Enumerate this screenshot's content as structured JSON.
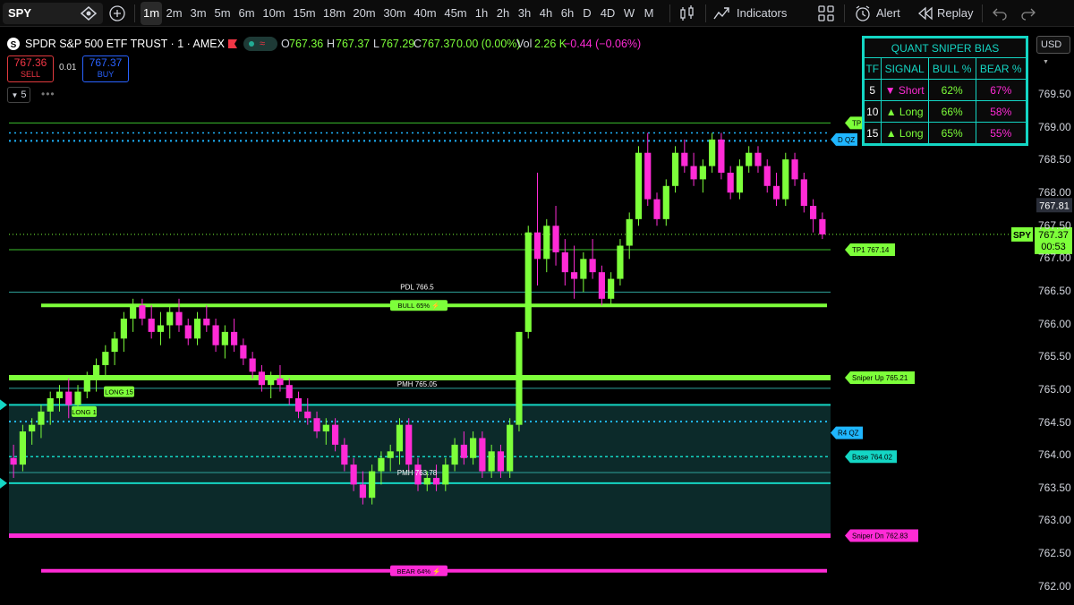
{
  "toolbar": {
    "symbol": "SPY",
    "intervals": [
      "1m",
      "2m",
      "3m",
      "5m",
      "6m",
      "10m",
      "15m",
      "18m",
      "20m",
      "30m",
      "40m",
      "45m",
      "1h",
      "2h",
      "3h",
      "4h",
      "6h",
      "D",
      "4D",
      "W",
      "M"
    ],
    "active_interval": "1m",
    "indicators_label": "Indicators",
    "alert_label": "Alert",
    "replay_label": "Replay"
  },
  "legend": {
    "title": "SPDR S&P 500 ETF TRUST · 1 · AMEX",
    "o_label": "O",
    "o": "767.36",
    "h_label": "H",
    "h": "767.37",
    "l_label": "L",
    "l": "767.29",
    "c_label": "C",
    "c": "767.37",
    "change": "0.00 (0.00%)",
    "vol_label": "Vol",
    "vol": "2.26 K",
    "delta": "−0.44 (−0.06%)"
  },
  "trade": {
    "sell_price": "767.36",
    "sell_label": "SELL",
    "spread": "0.01",
    "buy_price": "767.37",
    "buy_label": "BUY"
  },
  "collapse_count": "5",
  "bias_table": {
    "title": "QUANT SNIPER BIAS",
    "headers": [
      "TF",
      "SIGNAL",
      "BULL %",
      "BEAR %"
    ],
    "rows": [
      {
        "tf": "5",
        "signal": "▼ Short",
        "bull": "62%",
        "bear": "67%",
        "signal_color": "#ff2bd6"
      },
      {
        "tf": "10",
        "signal": "▲ Long",
        "bull": "66%",
        "bear": "58%",
        "signal_color": "#7dff3a"
      },
      {
        "tf": "15",
        "signal": "▲ Long",
        "bull": "65%",
        "bear": "55%",
        "signal_color": "#7dff3a"
      }
    ]
  },
  "price_scale": {
    "currency": "USD",
    "ticks": [
      "769.50",
      "769.00",
      "768.50",
      "768.00",
      "767.50",
      "767.00",
      "766.50",
      "766.00",
      "765.50",
      "765.00",
      "764.50",
      "764.00",
      "763.50",
      "763.00",
      "762.50",
      "762.00"
    ],
    "hover_price": "767.81",
    "last_symbol": "SPY",
    "last_price": "767.37",
    "countdown": "00:53"
  },
  "levels": {
    "tp1": "TP1 767.14",
    "tp_top": "TP",
    "dqz": "D QZ",
    "pdl": "PDL 766.5",
    "bull": "BULL 65% ⚡",
    "sniper_up": "Sniper Up 765.21",
    "pmh": "PMH 765.05",
    "r4qz": "R4 QZ",
    "base": "Base 764.02",
    "pmh2": "PMH 763.78",
    "sniper_dn": "Sniper Dn 762.83",
    "bear": "BEAR 64% ⚡",
    "long1": "LONG 1",
    "long15": "LONG 15"
  },
  "colors": {
    "bull": "#7dff3a",
    "bear": "#ff2bd6",
    "cyan": "#14d6c4",
    "sky": "#1fb6ff"
  },
  "chart_data": {
    "type": "candlestick",
    "symbol": "SPY",
    "timeframe": "1m",
    "ylim": [
      761.95,
      769.75
    ],
    "candles": [
      [
        764.0,
        764.2,
        763.7,
        763.9
      ],
      [
        763.9,
        764.5,
        763.8,
        764.4
      ],
      [
        764.4,
        764.6,
        764.2,
        764.5
      ],
      [
        764.5,
        764.8,
        764.3,
        764.7
      ],
      [
        764.7,
        765.0,
        764.5,
        764.9
      ],
      [
        764.9,
        765.1,
        764.7,
        765.0
      ],
      [
        765.0,
        765.2,
        764.6,
        764.8
      ],
      [
        764.8,
        765.1,
        764.7,
        765.0
      ],
      [
        765.0,
        765.3,
        764.9,
        765.2
      ],
      [
        765.2,
        765.5,
        765.0,
        765.4
      ],
      [
        765.4,
        765.7,
        765.2,
        765.6
      ],
      [
        765.6,
        765.9,
        765.4,
        765.8
      ],
      [
        765.8,
        766.2,
        765.6,
        766.1
      ],
      [
        766.1,
        766.4,
        765.9,
        766.3
      ],
      [
        766.3,
        766.4,
        766.0,
        766.1
      ],
      [
        766.1,
        766.3,
        765.8,
        765.9
      ],
      [
        765.9,
        766.2,
        765.7,
        766.0
      ],
      [
        766.0,
        766.3,
        765.8,
        766.2
      ],
      [
        766.2,
        766.4,
        765.9,
        766.0
      ],
      [
        766.0,
        766.1,
        765.7,
        765.8
      ],
      [
        765.8,
        766.2,
        765.7,
        766.1
      ],
      [
        766.1,
        766.3,
        765.9,
        766.0
      ],
      [
        766.0,
        766.1,
        765.6,
        765.7
      ],
      [
        765.7,
        766.0,
        765.5,
        765.9
      ],
      [
        765.9,
        766.1,
        765.6,
        765.7
      ],
      [
        765.7,
        765.8,
        765.4,
        765.5
      ],
      [
        765.5,
        765.6,
        765.2,
        765.3
      ],
      [
        765.3,
        765.4,
        765.0,
        765.1
      ],
      [
        765.1,
        765.3,
        764.9,
        765.2
      ],
      [
        765.2,
        765.4,
        765.0,
        765.1
      ],
      [
        765.1,
        765.2,
        764.8,
        764.9
      ],
      [
        764.9,
        765.0,
        764.6,
        764.7
      ],
      [
        764.7,
        764.9,
        764.5,
        764.6
      ],
      [
        764.6,
        764.7,
        764.3,
        764.4
      ],
      [
        764.4,
        764.6,
        764.2,
        764.5
      ],
      [
        764.5,
        764.6,
        764.1,
        764.2
      ],
      [
        764.2,
        764.3,
        763.8,
        763.9
      ],
      [
        763.9,
        764.0,
        763.5,
        763.6
      ],
      [
        763.6,
        763.8,
        763.3,
        763.4
      ],
      [
        763.4,
        763.9,
        763.3,
        763.8
      ],
      [
        763.8,
        764.1,
        763.6,
        764.0
      ],
      [
        764.0,
        764.2,
        763.8,
        764.1
      ],
      [
        764.1,
        764.6,
        763.9,
        764.5
      ],
      [
        764.5,
        764.6,
        763.8,
        763.9
      ],
      [
        763.9,
        764.0,
        763.5,
        763.6
      ],
      [
        763.6,
        763.8,
        763.5,
        763.7
      ],
      [
        763.7,
        763.9,
        763.5,
        763.6
      ],
      [
        763.6,
        764.0,
        763.5,
        763.9
      ],
      [
        763.9,
        764.3,
        763.8,
        764.2
      ],
      [
        764.2,
        764.4,
        763.9,
        764.0
      ],
      [
        764.0,
        764.4,
        763.9,
        764.3
      ],
      [
        764.3,
        764.4,
        763.7,
        763.8
      ],
      [
        763.8,
        764.2,
        763.7,
        764.1
      ],
      [
        764.1,
        764.2,
        763.7,
        763.8
      ],
      [
        763.8,
        764.6,
        763.7,
        764.5
      ],
      [
        764.5,
        765.9,
        764.4,
        765.9
      ],
      [
        765.9,
        767.5,
        765.8,
        767.4
      ],
      [
        767.4,
        768.3,
        766.6,
        767.0
      ],
      [
        767.0,
        767.6,
        766.8,
        767.5
      ],
      [
        767.5,
        767.8,
        766.9,
        767.1
      ],
      [
        767.1,
        767.3,
        766.6,
        766.8
      ],
      [
        766.8,
        767.2,
        766.4,
        766.7
      ],
      [
        766.7,
        767.1,
        766.5,
        767.0
      ],
      [
        767.0,
        767.3,
        766.7,
        766.8
      ],
      [
        766.8,
        766.9,
        766.3,
        766.4
      ],
      [
        766.4,
        766.8,
        766.3,
        766.7
      ],
      [
        766.7,
        767.3,
        766.6,
        767.2
      ],
      [
        767.2,
        767.7,
        767.0,
        767.6
      ],
      [
        767.6,
        768.7,
        767.5,
        768.6
      ],
      [
        768.6,
        768.9,
        767.8,
        767.9
      ],
      [
        767.9,
        768.0,
        767.5,
        767.6
      ],
      [
        767.6,
        768.2,
        767.5,
        768.1
      ],
      [
        768.1,
        768.7,
        768.0,
        768.6
      ],
      [
        768.6,
        768.8,
        768.3,
        768.4
      ],
      [
        768.4,
        768.6,
        768.1,
        768.2
      ],
      [
        768.2,
        768.5,
        768.0,
        768.4
      ],
      [
        768.4,
        768.9,
        768.3,
        768.8
      ],
      [
        768.8,
        768.9,
        768.2,
        768.3
      ],
      [
        768.3,
        768.4,
        767.9,
        768.0
      ],
      [
        768.0,
        768.5,
        767.9,
        768.4
      ],
      [
        768.4,
        768.7,
        768.3,
        768.6
      ],
      [
        768.6,
        768.7,
        768.3,
        768.4
      ],
      [
        768.4,
        768.5,
        768.0,
        768.1
      ],
      [
        768.1,
        768.3,
        767.8,
        767.9
      ],
      [
        767.9,
        768.6,
        767.8,
        768.5
      ],
      [
        768.5,
        768.6,
        768.1,
        768.2
      ],
      [
        768.2,
        768.3,
        767.7,
        767.8
      ],
      [
        767.8,
        767.9,
        767.4,
        767.6
      ],
      [
        767.6,
        767.7,
        767.3,
        767.37
      ]
    ]
  }
}
